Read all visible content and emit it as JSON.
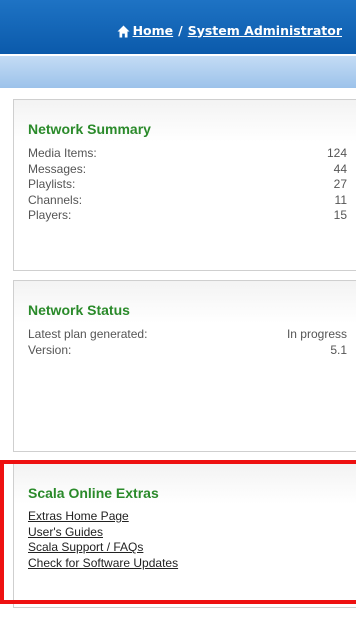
{
  "header": {
    "home_label": "Home",
    "separator": "/",
    "admin_label": "System Administrator",
    "background_color": "#0b5aab"
  },
  "network_summary": {
    "title": "Network Summary",
    "rows": [
      {
        "label": "Media Items:",
        "value": "124"
      },
      {
        "label": "Messages:",
        "value": "44"
      },
      {
        "label": "Playlists:",
        "value": "27"
      },
      {
        "label": "Channels:",
        "value": "11"
      },
      {
        "label": "Players:",
        "value": "15"
      }
    ]
  },
  "network_status": {
    "title": "Network Status",
    "rows": [
      {
        "label": "Latest plan generated:",
        "value": "In progress"
      },
      {
        "label": "Version:",
        "value": "5.1"
      }
    ]
  },
  "online_extras": {
    "title": "Scala Online Extras",
    "links": [
      "Extras Home Page",
      "User's Guides",
      "Scala Support / FAQs",
      "Check for Software Updates"
    ],
    "highlight_color": "#ee1111"
  },
  "colors": {
    "title_green": "#2a8a2a",
    "text_gray": "#555555"
  }
}
